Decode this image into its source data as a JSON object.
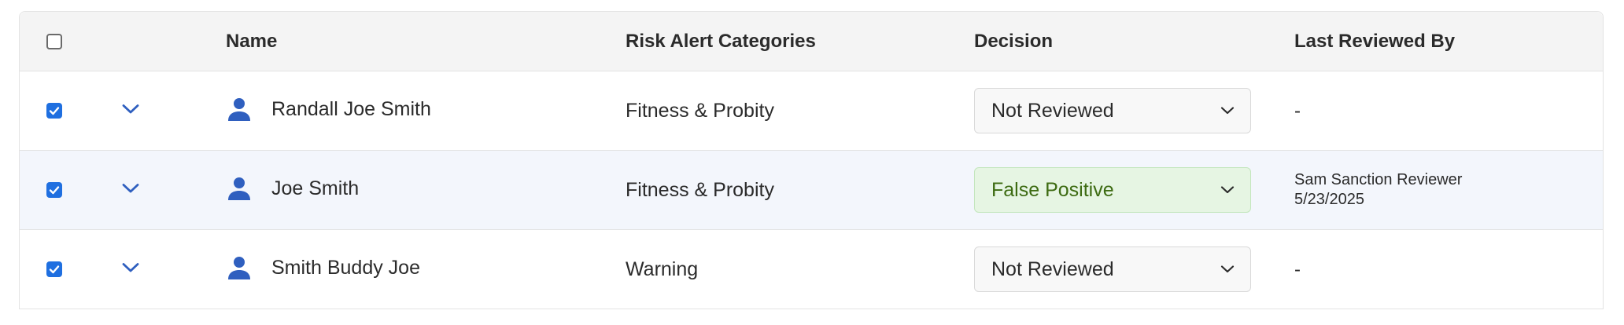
{
  "table": {
    "columns": {
      "name": "Name",
      "risk": "Risk Alert Categories",
      "decision": "Decision",
      "reviewed": "Last Reviewed By"
    },
    "header_checked": false,
    "rows": [
      {
        "checked": true,
        "name": "Randall Joe Smith",
        "risk": "Fitness & Probity",
        "decision": "Not Reviewed",
        "reviewed_line1": "-",
        "reviewed_line2": ""
      },
      {
        "checked": true,
        "name": "Joe Smith",
        "risk": "Fitness & Probity",
        "decision": "False Positive",
        "reviewed_line1": "Sam Sanction Reviewer",
        "reviewed_line2": "5/23/2025"
      },
      {
        "checked": true,
        "name": "Smith Buddy Joe",
        "risk": "Warning",
        "decision": "Not Reviewed",
        "reviewed_line1": "-",
        "reviewed_line2": ""
      }
    ]
  },
  "icons": {
    "row_expand": "chevron-down-icon",
    "person": "person-icon",
    "select_arrow": "chevron-down-icon",
    "check": "checkmark-icon"
  },
  "colors": {
    "accent_blue": "#1f6fe0",
    "person_icon_blue": "#2f5fbf",
    "highlight_row": "#f3f6fc",
    "positive_bg": "#e6f5e3",
    "positive_text": "#3d6b12"
  }
}
